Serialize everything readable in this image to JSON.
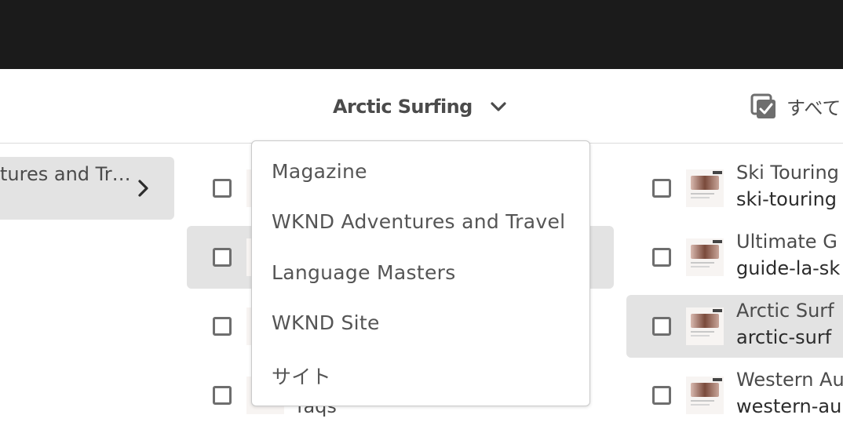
{
  "header": {
    "title": "Arctic Surfing",
    "select_all_label": "すべて"
  },
  "column1": {
    "selected_item_label": "tures and Tr…"
  },
  "column2": {
    "partial_label": "faqs"
  },
  "column3": {
    "items": [
      {
        "title": "Ski Touring",
        "name": "ski-touring"
      },
      {
        "title": "Ultimate G",
        "name": "guide-la-sk"
      },
      {
        "title": "Arctic Surf",
        "name": "arctic-surf"
      },
      {
        "title": "Western Au",
        "name": "western-au"
      }
    ]
  },
  "dropdown": {
    "options": [
      "Magazine",
      "WKND Adventures and Travel",
      "Language Masters",
      "WKND Site",
      "サイト"
    ]
  },
  "colors": {
    "topbar": "#1b1b1b",
    "highlight": "#e3e3e3",
    "text": "#4b4b4b"
  },
  "icons": [
    "chevron-down-icon",
    "select-all-checkbox-icon",
    "chevron-right-icon",
    "checkbox-icon",
    "page-thumbnail-icon"
  ]
}
